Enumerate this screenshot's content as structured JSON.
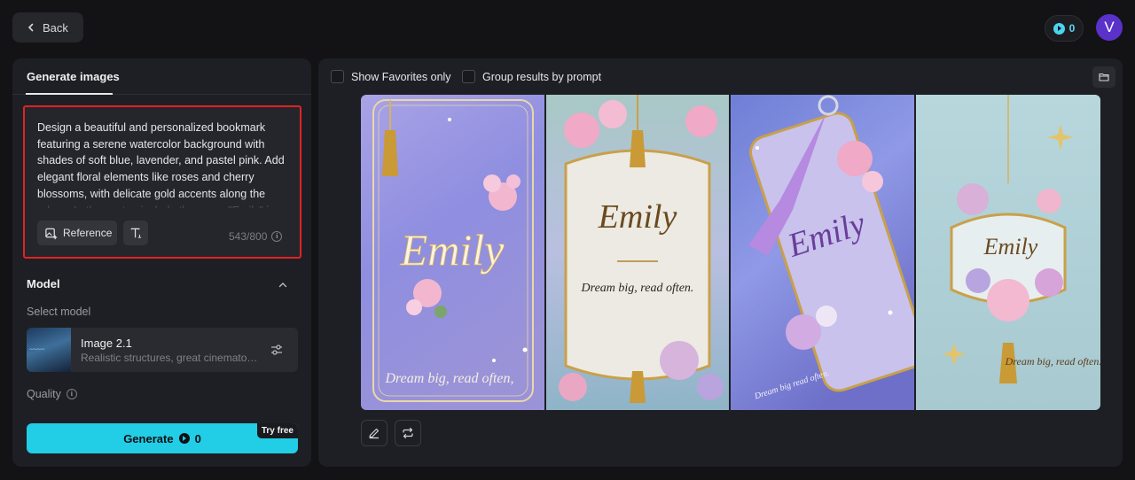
{
  "header": {
    "back_label": "Back",
    "credits": "0",
    "avatar_initial": "V"
  },
  "left_panel": {
    "tab_label": "Generate images",
    "prompt_text": "Design a beautiful and personalized bookmark featuring a serene watercolor background with shades of soft blue, lavender, and pastel pink. Add elegant floral elements like roses and cherry blossoms, with delicate gold accents along the edges. In the center, include the name \"Emily\" in",
    "reference_label": "Reference",
    "char_count": "543/800",
    "model_section_title": "Model",
    "select_model_label": "Select model",
    "model_name": "Image 2.1",
    "model_description": "Realistic structures, great cinematog...",
    "quality_label": "Quality",
    "generate_label": "Generate",
    "generate_cost": "0",
    "try_free_label": "Try free"
  },
  "right_panel": {
    "show_favorites_label": "Show Favorites only",
    "group_results_label": "Group results by prompt",
    "images": [
      {
        "name": "Emily",
        "tagline": "Dream big, read often,"
      },
      {
        "name": "Emily",
        "tagline": "Dream big, read often."
      },
      {
        "name": "Emily",
        "tagline": "Dream big read often."
      },
      {
        "name": "Emily",
        "tagline": "Dream big, read often."
      }
    ]
  },
  "colors": {
    "accent": "#22cde6",
    "highlight_border": "#e02323",
    "avatar": "#5a31c9"
  },
  "icons": [
    "chevron-left-icon",
    "credit-icon",
    "image-plus-icon",
    "text-icon",
    "info-icon",
    "chevron-up-icon",
    "sliders-icon",
    "folder-icon",
    "edit-icon",
    "repeat-icon"
  ]
}
